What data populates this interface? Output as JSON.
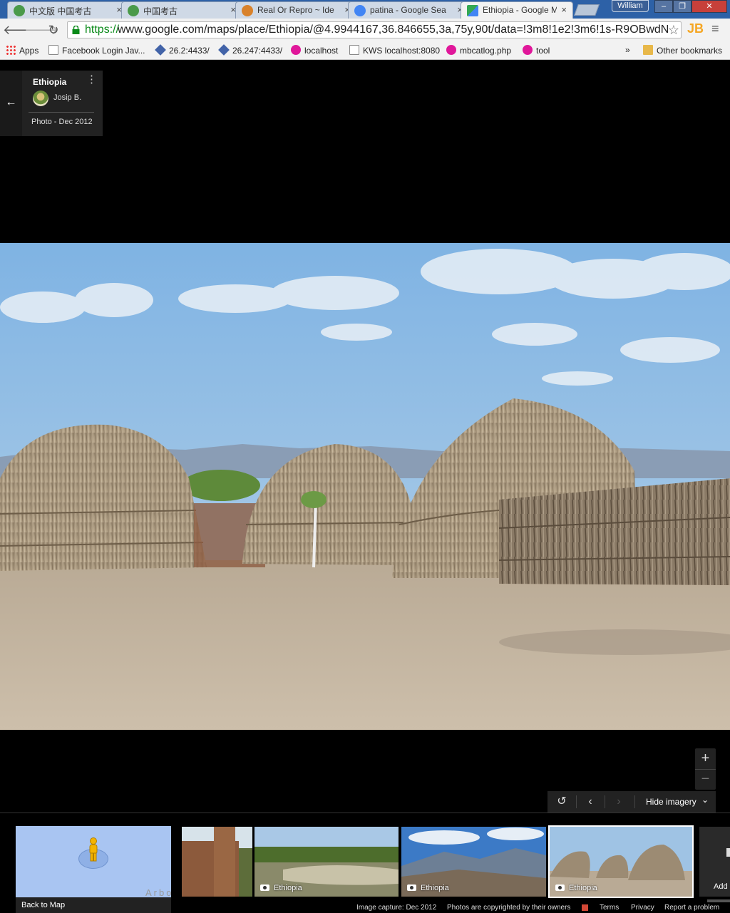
{
  "browser": {
    "tabs": [
      {
        "title": "中文版 中国考古",
        "close": "×",
        "favicon_color": "#4a9a4a"
      },
      {
        "title": "中国考古",
        "close": "×",
        "favicon_color": "#4a9a4a"
      },
      {
        "title": "Real Or Repro ~ Ide",
        "close": "×",
        "favicon_color": "#d9822b"
      },
      {
        "title": "patina - Google Sea",
        "close": "×",
        "favicon_color": "#4285f4"
      },
      {
        "title": "Ethiopia - Google M",
        "close": "×",
        "favicon_color": "#34a853",
        "active": true
      }
    ],
    "profile_name": "William",
    "window_buttons": {
      "minimize": "‒",
      "maximize": "❐",
      "close": "✕"
    },
    "nav": {
      "back": "🡐",
      "forward": "🡒",
      "reload": "↻"
    },
    "url_scheme": "https://",
    "url_rest": "www.google.com/maps/place/Ethiopia/@4.9944167,36.846655,3a,75y,90t/data=!3m8!1e2!3m6!1s-R9OBwdN",
    "bookmark_star": "☆",
    "extension": "JB",
    "menu_icon": "≡"
  },
  "bookmarks": [
    {
      "label": "Apps",
      "icon": "grid"
    },
    {
      "label": "Facebook Login Jav...",
      "icon": "page"
    },
    {
      "label": "26.2:4433/",
      "icon": "sat"
    },
    {
      "label": "26.247:4433/",
      "icon": "sat"
    },
    {
      "label": "localhost",
      "icon": "pink"
    },
    {
      "label": "KWS localhost:8080",
      "icon": "page"
    },
    {
      "label": "mbcatlog.php",
      "icon": "pink"
    },
    {
      "label": "tool",
      "icon": "pink"
    }
  ],
  "bookmarks_overflow": "»",
  "other_bookmarks": "Other bookmarks",
  "infocard": {
    "back_arrow": "←",
    "title": "Ethiopia",
    "more": "⋮",
    "author": "Josip B.",
    "date": "Photo - Dec 2012"
  },
  "zoom": {
    "in": "+",
    "out": "−"
  },
  "imagery_bar": {
    "rotate": "↺",
    "prev": "‹",
    "next": "›",
    "hide_label": "Hide imagery",
    "hide_chevron": "⌄"
  },
  "minimap": {
    "map_text": "Arbo",
    "back_label": "Back to Map"
  },
  "thumbnails": [
    {
      "label": ""
    },
    {
      "label": "Ethiopia"
    },
    {
      "label": "Ethiopia"
    },
    {
      "label": "Ethiopia",
      "selected": true
    }
  ],
  "add_photo_label": "Add",
  "footer": {
    "capture": "Image capture: Dec 2012",
    "copyright": "Photos are copyrighted by their owners",
    "terms": "Terms",
    "privacy": "Privacy",
    "report": "Report a problem"
  },
  "colors": {
    "tabstrip": "#2d61a7",
    "chrome": "#f2f2f2",
    "url_secure": "#0a8a19",
    "panel": "#222222",
    "minimap": "#a9c5f2"
  }
}
